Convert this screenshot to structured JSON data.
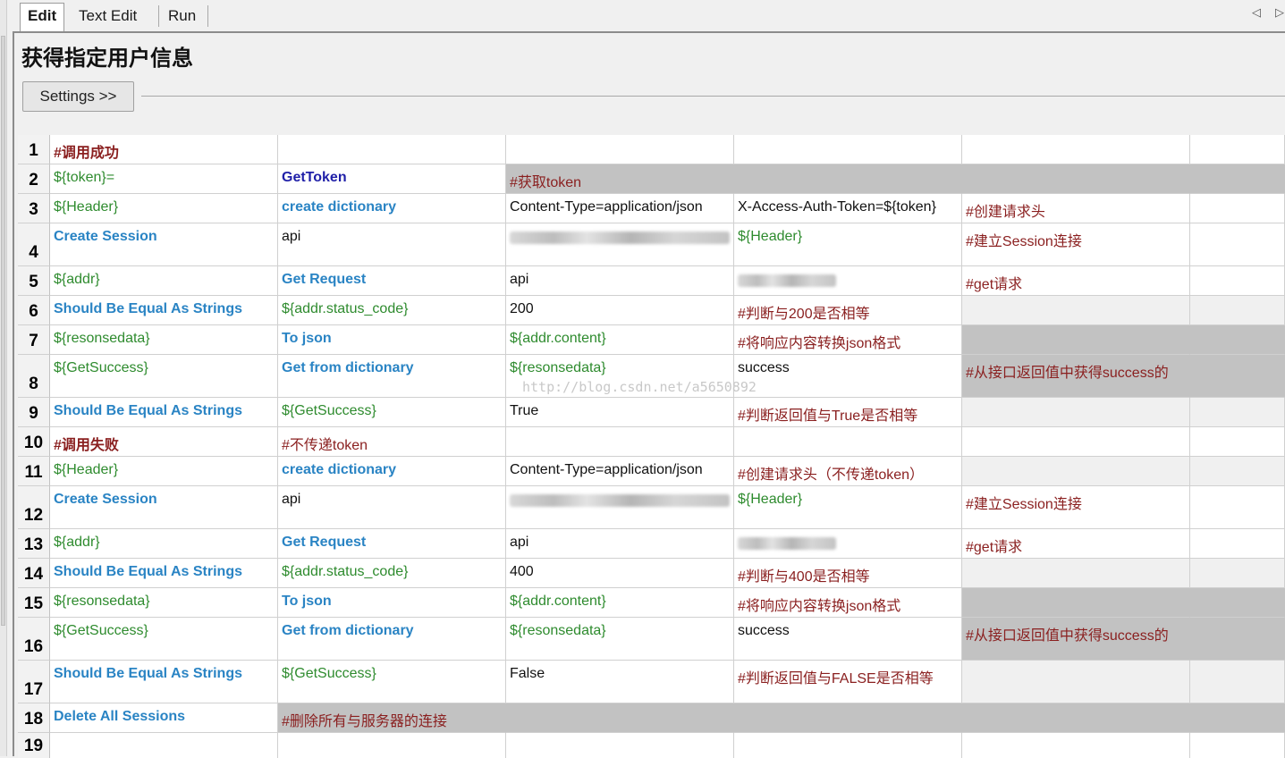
{
  "tabs": [
    {
      "label": "Edit",
      "active": true
    },
    {
      "label": "Text Edit",
      "active": false
    },
    {
      "label": "Run",
      "active": false
    }
  ],
  "title": "获得指定用户信息",
  "settings_label": "Settings >>",
  "watermark": "http://blog.csdn.net/a5650892",
  "colors": {
    "comment": "#8a1f1f",
    "variable": "#2e8b2e",
    "keyword": "#2a84c4",
    "keyword_dark": "#1f1fa8",
    "gray_fill": "#c2c2c2"
  },
  "rows": [
    {
      "n": "1",
      "cells": [
        {
          "t": "#调用成功",
          "s": "comment-bold"
        },
        {
          "t": ""
        },
        {
          "t": ""
        },
        {
          "t": ""
        },
        {
          "t": ""
        },
        {
          "t": ""
        }
      ]
    },
    {
      "n": "2",
      "cells": [
        {
          "t": "${token}=",
          "s": "var"
        },
        {
          "t": "GetToken",
          "s": "kw-dark"
        },
        {
          "t": "#获取token",
          "s": "comment",
          "gray": true
        },
        {
          "t": "",
          "gray": true
        },
        {
          "t": "",
          "gray": true
        },
        {
          "t": "",
          "gray": true
        }
      ]
    },
    {
      "n": "3",
      "cells": [
        {
          "t": "${Header}",
          "s": "var"
        },
        {
          "t": "create dictionary",
          "s": "kw"
        },
        {
          "t": "Content-Type=application/json",
          "s": "plain"
        },
        {
          "t": "X-Access-Auth-Token=${token}",
          "s": "plain"
        },
        {
          "t": "#创建请求头",
          "s": "comment"
        },
        {
          "t": ""
        }
      ]
    },
    {
      "n": "4",
      "cells": [
        {
          "t": "Create Session",
          "s": "kw"
        },
        {
          "t": "api",
          "s": "plain"
        },
        {
          "t": "",
          "blur": true
        },
        {
          "t": "${Header}",
          "s": "var"
        },
        {
          "t": "#建立Session连接",
          "s": "comment"
        },
        {
          "t": ""
        }
      ]
    },
    {
      "n": "5",
      "cells": [
        {
          "t": "${addr}",
          "s": "var"
        },
        {
          "t": "Get Request",
          "s": "kw"
        },
        {
          "t": "api",
          "s": "plain"
        },
        {
          "t": "",
          "blur": true
        },
        {
          "t": "#get请求",
          "s": "comment"
        },
        {
          "t": ""
        }
      ]
    },
    {
      "n": "6",
      "cells": [
        {
          "t": "Should Be Equal As Strings",
          "s": "kw"
        },
        {
          "t": "${addr.status_code}",
          "s": "var"
        },
        {
          "t": "200",
          "s": "plain"
        },
        {
          "t": "#判断与200是否相等",
          "s": "comment"
        },
        {
          "t": "",
          "light": true
        },
        {
          "t": "",
          "light": true
        }
      ]
    },
    {
      "n": "7",
      "cells": [
        {
          "t": "${resonsedata}",
          "s": "var"
        },
        {
          "t": "To json",
          "s": "kw"
        },
        {
          "t": "${addr.content}",
          "s": "var"
        },
        {
          "t": "#将响应内容转换json格式",
          "s": "comment"
        },
        {
          "t": "",
          "gray": true
        },
        {
          "t": "",
          "gray": true
        }
      ]
    },
    {
      "n": "8",
      "cells": [
        {
          "t": "${GetSuccess}",
          "s": "var"
        },
        {
          "t": "Get from dictionary",
          "s": "kw"
        },
        {
          "t": "${resonsedata}",
          "s": "var"
        },
        {
          "t": "success",
          "s": "plain"
        },
        {
          "t": "#从接口返回值中获得success的",
          "s": "comment",
          "gray": true
        },
        {
          "t": "",
          "gray": true
        }
      ]
    },
    {
      "n": "9",
      "cells": [
        {
          "t": "Should Be Equal As Strings",
          "s": "kw"
        },
        {
          "t": "${GetSuccess}",
          "s": "var"
        },
        {
          "t": "True",
          "s": "plain"
        },
        {
          "t": "#判断返回值与True是否相等",
          "s": "comment"
        },
        {
          "t": "",
          "light": true
        },
        {
          "t": "",
          "light": true
        }
      ]
    },
    {
      "n": "10",
      "cells": [
        {
          "t": "#调用失败",
          "s": "comment-bold"
        },
        {
          "t": "#不传递token",
          "s": "comment"
        },
        {
          "t": ""
        },
        {
          "t": ""
        },
        {
          "t": ""
        },
        {
          "t": ""
        }
      ]
    },
    {
      "n": "11",
      "cells": [
        {
          "t": "${Header}",
          "s": "var"
        },
        {
          "t": "create dictionary",
          "s": "kw"
        },
        {
          "t": "Content-Type=application/json",
          "s": "plain"
        },
        {
          "t": "#创建请求头（不传递token）",
          "s": "comment"
        },
        {
          "t": "",
          "light": true
        },
        {
          "t": "",
          "light": true
        }
      ]
    },
    {
      "n": "12",
      "cells": [
        {
          "t": "Create Session",
          "s": "kw"
        },
        {
          "t": "api",
          "s": "plain"
        },
        {
          "t": "",
          "blur": true
        },
        {
          "t": "${Header}",
          "s": "var"
        },
        {
          "t": "#建立Session连接",
          "s": "comment"
        },
        {
          "t": ""
        }
      ]
    },
    {
      "n": "13",
      "cells": [
        {
          "t": "${addr}",
          "s": "var"
        },
        {
          "t": "Get Request",
          "s": "kw"
        },
        {
          "t": "api",
          "s": "plain"
        },
        {
          "t": "",
          "blur": true
        },
        {
          "t": "#get请求",
          "s": "comment"
        },
        {
          "t": ""
        }
      ]
    },
    {
      "n": "14",
      "cells": [
        {
          "t": "Should Be Equal As Strings",
          "s": "kw"
        },
        {
          "t": "${addr.status_code}",
          "s": "var"
        },
        {
          "t": "400",
          "s": "plain"
        },
        {
          "t": "#判断与400是否相等",
          "s": "comment"
        },
        {
          "t": "",
          "light": true
        },
        {
          "t": "",
          "light": true
        }
      ]
    },
    {
      "n": "15",
      "cells": [
        {
          "t": "${resonsedata}",
          "s": "var"
        },
        {
          "t": "To json",
          "s": "kw"
        },
        {
          "t": "${addr.content}",
          "s": "var"
        },
        {
          "t": "#将响应内容转换json格式",
          "s": "comment"
        },
        {
          "t": "",
          "gray": true
        },
        {
          "t": "",
          "gray": true
        }
      ]
    },
    {
      "n": "16",
      "cells": [
        {
          "t": "${GetSuccess}",
          "s": "var"
        },
        {
          "t": "Get from dictionary",
          "s": "kw"
        },
        {
          "t": "${resonsedata}",
          "s": "var"
        },
        {
          "t": "success",
          "s": "plain"
        },
        {
          "t": "#从接口返回值中获得success的",
          "s": "comment",
          "gray": true
        },
        {
          "t": "",
          "gray": true
        }
      ]
    },
    {
      "n": "17",
      "cells": [
        {
          "t": "Should Be Equal As Strings",
          "s": "kw"
        },
        {
          "t": "${GetSuccess}",
          "s": "var"
        },
        {
          "t": "False",
          "s": "plain"
        },
        {
          "t": "#判断返回值与FALSE是否相等",
          "s": "comment"
        },
        {
          "t": "",
          "light": true
        },
        {
          "t": "",
          "light": true
        }
      ]
    },
    {
      "n": "18",
      "cells": [
        {
          "t": "Delete All Sessions",
          "s": "kw"
        },
        {
          "t": "#删除所有与服务器的连接",
          "s": "comment",
          "gray": true
        },
        {
          "t": "",
          "gray": true
        },
        {
          "t": "",
          "gray": true
        },
        {
          "t": "",
          "gray": true
        },
        {
          "t": "",
          "gray": true
        }
      ]
    },
    {
      "n": "19",
      "cells": [
        {
          "t": ""
        },
        {
          "t": ""
        },
        {
          "t": ""
        },
        {
          "t": ""
        },
        {
          "t": ""
        },
        {
          "t": ""
        }
      ]
    }
  ]
}
